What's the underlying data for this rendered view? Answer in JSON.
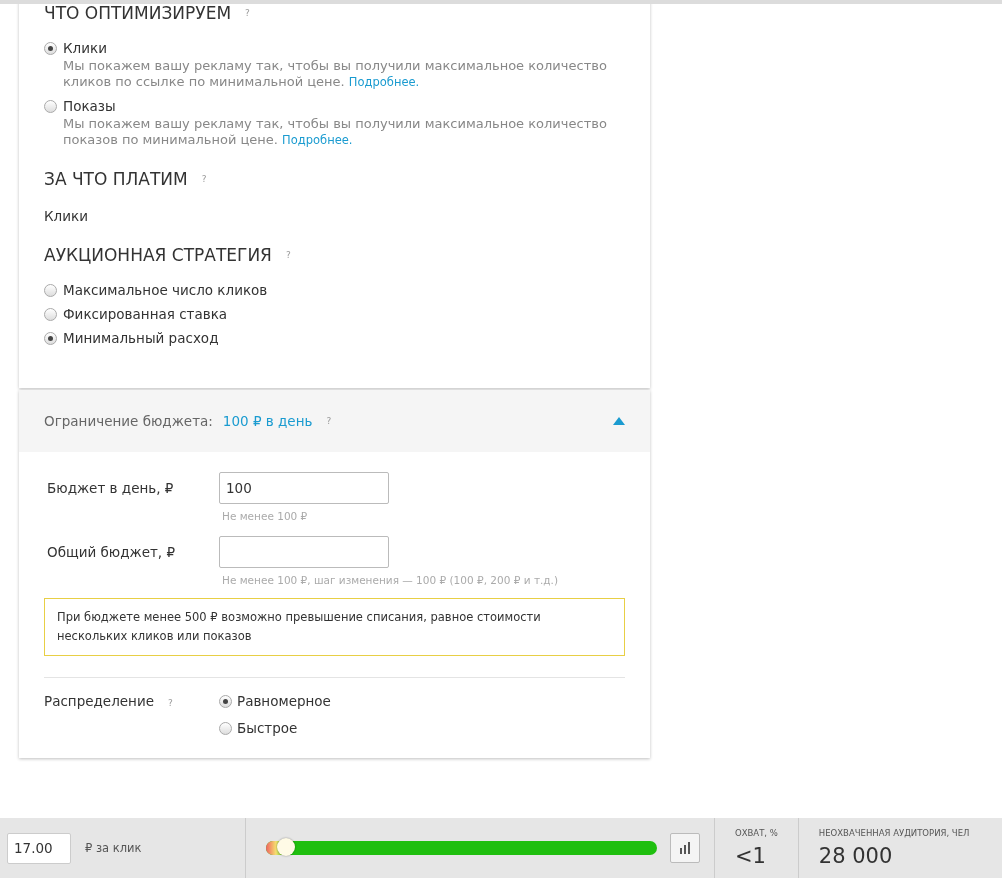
{
  "sections": [
    {
      "kind": "radio",
      "title": "ЧТО ОПТИМИЗИРУЕМ",
      "help": "?",
      "options": [
        {
          "label": "Клики",
          "selected": true,
          "description": "Мы покажем вашу рекламу так, чтобы вы получили максимальное количество кликов по ссылке по минимальной цене.",
          "link": "Подробнее."
        },
        {
          "label": "Показы",
          "selected": false,
          "description": "Мы покажем вашу рекламу так, чтобы вы получили максимальное количество показов по минимальной цене.",
          "link": "Подробнее."
        }
      ]
    },
    {
      "kind": "text",
      "title": "ЗА ЧТО ПЛАТИМ",
      "help": "?",
      "value": "Клики"
    },
    {
      "kind": "radio",
      "title": "АУКЦИОННАЯ СТРАТЕГИЯ",
      "help": "?",
      "options": [
        {
          "label": "Максимальное число кликов",
          "selected": false
        },
        {
          "label": "Фиксированная ставка",
          "selected": false
        },
        {
          "label": "Минимальный расход",
          "selected": true
        }
      ]
    }
  ],
  "budget": {
    "label": "Ограничение бюджета:",
    "value": "100 ₽ в день",
    "help": "?",
    "expanded": true,
    "fields": [
      {
        "label": "Бюджет в день, ₽",
        "value": "100",
        "hint": "Не менее 100 ₽"
      },
      {
        "label": "Общий бюджет, ₽",
        "hint": "Не менее 100 ₽, шаг изменения — 100 ₽ (100 ₽, 200 ₽ и т.д.)"
      }
    ],
    "warning": "При бюджете менее 500 ₽ возможно превышение списания, равное стоимости нескольких кликов или показов",
    "distribution": {
      "label": "Распределение",
      "help": "?",
      "options": [
        {
          "label": "Равномерное",
          "selected": true
        },
        {
          "label": "Быстрое",
          "selected": false
        }
      ]
    }
  },
  "footer": {
    "bid": {
      "value": "17.00",
      "unit": "₽ за клик"
    },
    "slider": {
      "level": 0.05
    },
    "stats": [
      {
        "label": "ОХВАТ, %",
        "value": "<1"
      },
      {
        "label": "НЕОХВАЧЕННАЯ АУДИТОРИЯ, ЧЕЛ",
        "value": "28 000"
      }
    ]
  }
}
